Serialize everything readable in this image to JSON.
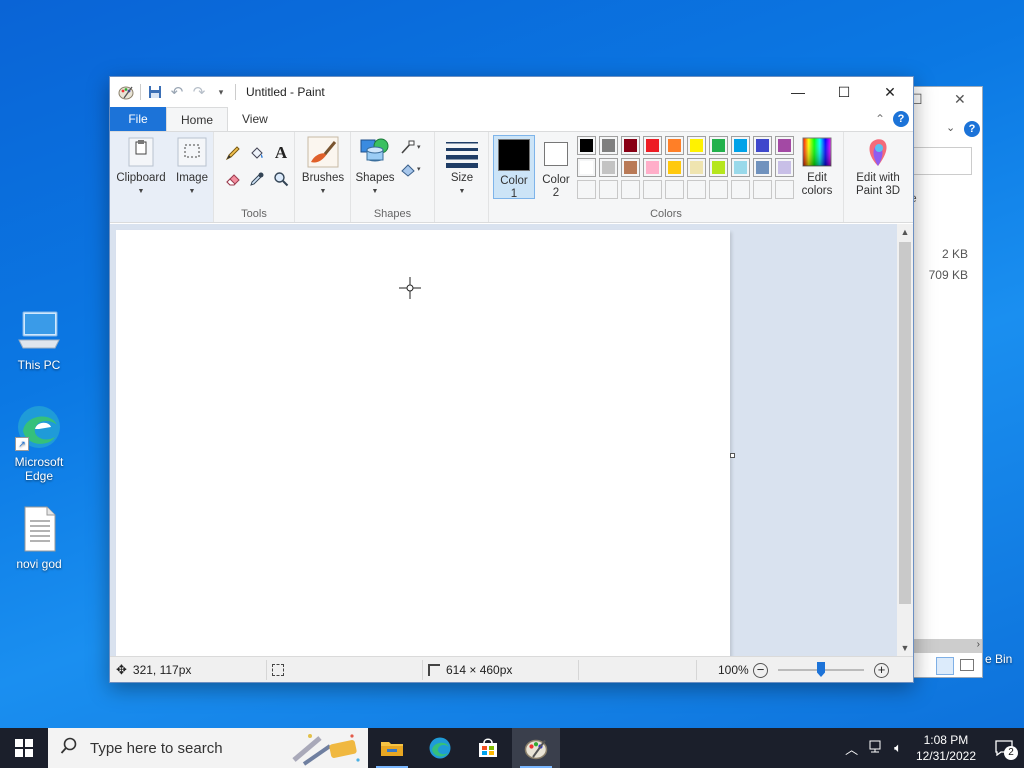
{
  "desktop": {
    "icons": [
      {
        "label": "This PC"
      },
      {
        "label": "Microsoft Edge"
      },
      {
        "label": "novi god"
      }
    ],
    "recycle_bin_label": "e Bin"
  },
  "explorer": {
    "sizes": [
      "2 KB",
      "709 KB"
    ],
    "partial_text": "e"
  },
  "paint": {
    "title": "Untitled - Paint",
    "tabs": {
      "file": "File",
      "home": "Home",
      "view": "View"
    },
    "ribbon": {
      "clipboard": "Clipboard",
      "image": "Image",
      "tools_label": "Tools",
      "brushes": "Brushes",
      "shapes": "Shapes",
      "shapes_label": "Shapes",
      "size": "Size",
      "color1_line1": "Color",
      "color1_line2": "1",
      "color2_line1": "Color",
      "color2_line2": "2",
      "colors_label": "Colors",
      "edit_colors_line1": "Edit",
      "edit_colors_line2": "colors",
      "paint3d_line1": "Edit with",
      "paint3d_line2": "Paint 3D"
    },
    "palette": {
      "row1": [
        "#000000",
        "#7f7f7f",
        "#880015",
        "#ed1c24",
        "#ff7f27",
        "#fff200",
        "#22b14c",
        "#00a2e8",
        "#3f48cc",
        "#a349a4"
      ],
      "row2": [
        "#ffffff",
        "#c3c3c3",
        "#b97a57",
        "#ffaec9",
        "#ffc90e",
        "#efe4b0",
        "#b5e61d",
        "#99d9ea",
        "#7092be",
        "#c8bfe7"
      ],
      "row3": [
        "#f5f6f7",
        "#f5f6f7",
        "#f5f6f7",
        "#f5f6f7",
        "#f5f6f7",
        "#f5f6f7",
        "#f5f6f7",
        "#f5f6f7",
        "#f5f6f7",
        "#f5f6f7"
      ]
    },
    "color1": "#000000",
    "color2": "#ffffff",
    "status": {
      "cursor_pos": "321, 117px",
      "canvas_size": "614 × 460px",
      "zoom": "100%",
      "zoom_level": 0.5
    }
  },
  "taskbar": {
    "search_placeholder": "Type here to search",
    "time": "1:08 PM",
    "date": "12/31/2022",
    "notification_count": "2"
  }
}
